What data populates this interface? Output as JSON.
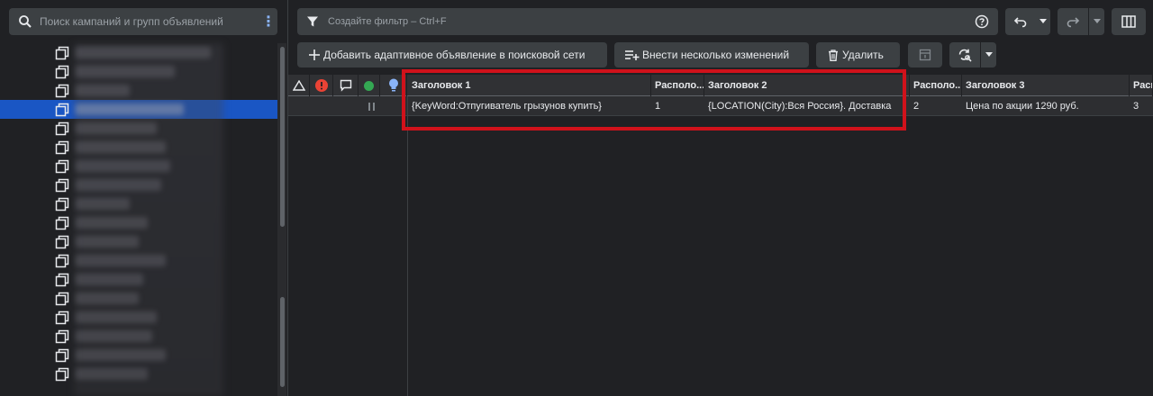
{
  "sidebar": {
    "search_placeholder": "Поиск кампаний и групп объявлений",
    "items_count_visible": 18,
    "selected_index": 3
  },
  "filter": {
    "placeholder": "Создайте фильтр – Ctrl+F"
  },
  "toolbar": {
    "add_label": "Добавить адаптивное объявление в поисковой сети",
    "bulk_edit_label": "Внести несколько изменений",
    "delete_label": "Удалить"
  },
  "grid": {
    "columns": [
      {
        "key": "h1",
        "label": "Заголовок 1"
      },
      {
        "key": "p1",
        "label": "Располо..."
      },
      {
        "key": "h2",
        "label": "Заголовок 2"
      },
      {
        "key": "p2",
        "label": "Располо..."
      },
      {
        "key": "h3",
        "label": "Заголовок 3"
      },
      {
        "key": "p3",
        "label": "Расп"
      }
    ],
    "rows": [
      {
        "h1": "{KeyWord:Отпугиватель грызунов купить}",
        "p1": "1",
        "h2": "{LOCATION(City):Вся Россия}. Доставка",
        "p2": "2",
        "h3": "Цена по акции 1290 руб.",
        "p3": "3",
        "status": "paused"
      }
    ]
  },
  "colors": {
    "background": "#202124",
    "panel": "#3c4043",
    "selected": "#1a56c4",
    "error": "#ea4335",
    "ok": "#34a853",
    "tip": "#8ab4f8",
    "highlight": "#d0121b"
  }
}
